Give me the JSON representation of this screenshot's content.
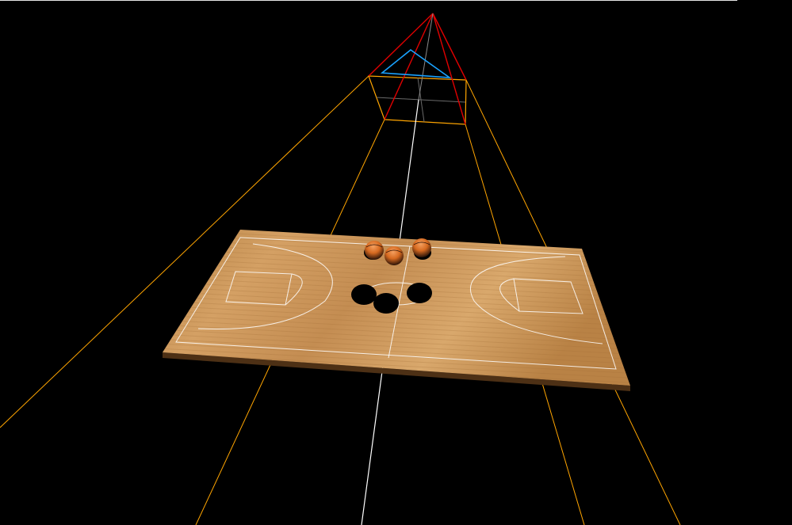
{
  "scene": {
    "background_color": "#000000",
    "frustum_colors": {
      "far": "#ffa500",
      "near": "#ffa500",
      "cone": "#ff0000",
      "up_triangle": "#00aaff",
      "target_line": "#ffffff",
      "cross": "#888888"
    },
    "court": {
      "wood_color": "#c8924f",
      "line_color": "#ffffff",
      "edge_color": "#7a4f22"
    },
    "basketballs": {
      "count": 3,
      "color": "#e07020",
      "shadow_count": 4
    }
  }
}
